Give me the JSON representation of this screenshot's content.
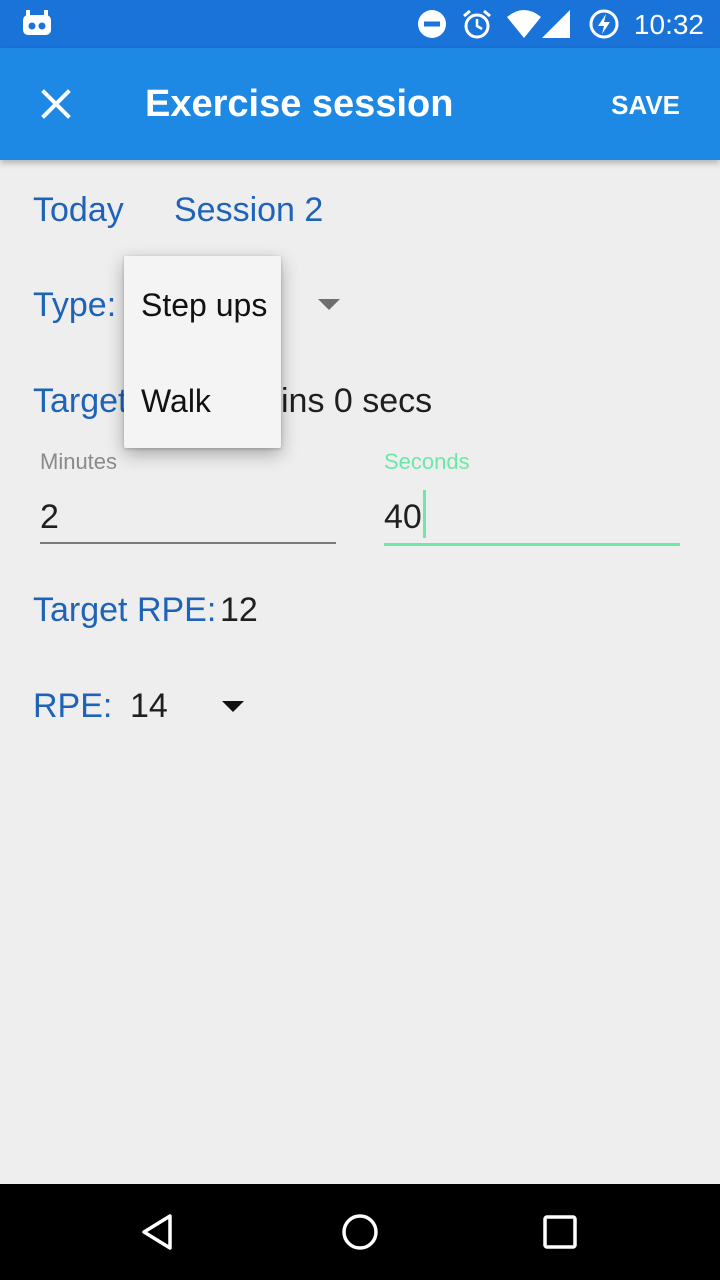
{
  "status_bar": {
    "time": "10:32",
    "icons": [
      "app-notification-icon",
      "do-not-disturb-icon",
      "alarm-icon",
      "wifi-icon",
      "cell-signal-icon",
      "battery-charging-icon"
    ]
  },
  "app_bar": {
    "title": "Exercise session",
    "save_label": "SAVE",
    "close_icon": "close-icon"
  },
  "session": {
    "date": "Today",
    "name": "Session 2"
  },
  "type_field": {
    "label": "Type:"
  },
  "dropdown": {
    "options": [
      "Step ups",
      "Walk"
    ]
  },
  "target": {
    "label_visible": "Target",
    "value_visible": "ins 0 secs"
  },
  "minutes": {
    "label": "Minutes",
    "value": "2"
  },
  "seconds": {
    "label": "Seconds",
    "value": "40"
  },
  "target_rpe": {
    "label": "Target RPE:",
    "value": "12"
  },
  "rpe": {
    "label": "RPE:",
    "value": "14"
  },
  "colors": {
    "status_bar": "#1a73d9",
    "app_bar": "#1e88e5",
    "label_blue": "#1e63b8",
    "focus_green": "#6ce8a8",
    "background": "#eeeeee"
  },
  "nav_bar": {
    "icons": [
      "back-icon",
      "home-icon",
      "recents-icon"
    ]
  }
}
